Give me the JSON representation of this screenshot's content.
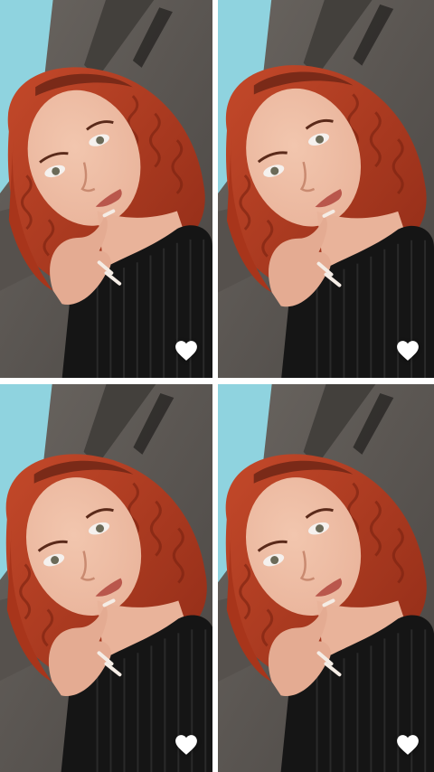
{
  "gallery": {
    "photos": [
      {
        "liked": true,
        "heart_icon": "heart-icon"
      },
      {
        "liked": true,
        "heart_icon": "heart-icon"
      },
      {
        "liked": true,
        "heart_icon": "heart-icon"
      },
      {
        "liked": true,
        "heart_icon": "heart-icon"
      }
    ],
    "colors": {
      "background": "#ffffff",
      "sky": "#8fd3df",
      "sofa": "#5e5955",
      "hair": "#b43a1e",
      "skin": "#e9b39a",
      "top": "#151515",
      "heart": "#ffffff"
    }
  }
}
